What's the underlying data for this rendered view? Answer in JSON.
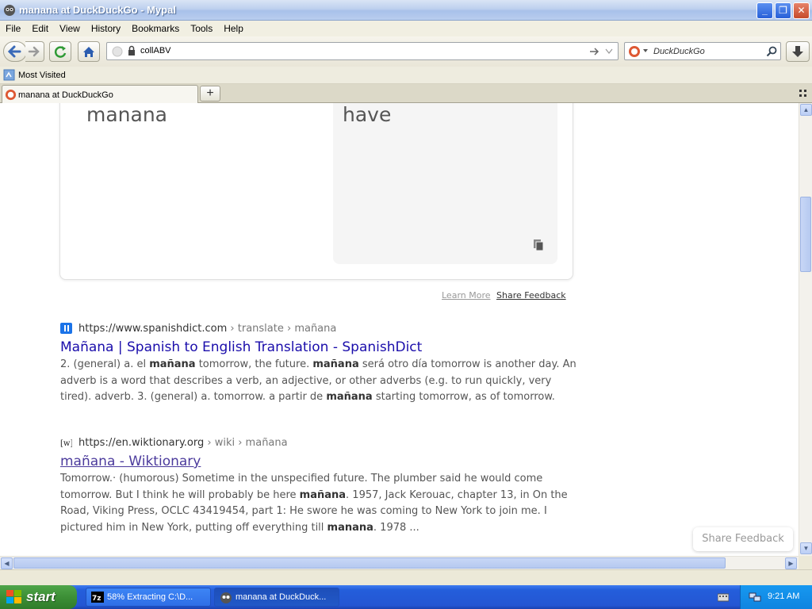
{
  "window": {
    "title": "manana at DuckDuckGo - Mypal"
  },
  "menu": [
    "File",
    "Edit",
    "View",
    "History",
    "Bookmarks",
    "Tools",
    "Help"
  ],
  "navbar": {
    "url": "collABV",
    "search_placeholder": "DuckDuckGo"
  },
  "bookmarks": {
    "most_visited": "Most Visited"
  },
  "tabs": [
    {
      "label": "manana at DuckDuckGo"
    }
  ],
  "translate": {
    "source_text": "manana",
    "target_text": "have",
    "learn_more": "Learn More",
    "share_feedback": "Share Feedback"
  },
  "results": [
    {
      "domain": "https://www.spanishdict.com",
      "path": " › translate › mañana",
      "title": "Mañana | Spanish to English Translation - SpanishDict",
      "snippet_html": "2. (general) a. el <b>mañana</b> tomorrow, the future. <b>mañana</b> será otro día tomorrow is another day. An adverb is a word that describes a verb, an adjective, or other adverbs (e.g. to run quickly, very tired). adverb. 3. (general) a. tomorrow. a partir de <b>mañana</b> starting tomorrow, as of tomorrow."
    },
    {
      "domain": "https://en.wiktionary.org",
      "path": " › wiki › mañana",
      "title": "mañana - Wiktionary",
      "snippet_html": "Tomorrow.· (humorous) Sometime in the unspecified future. The plumber said he would come tomorrow. But I think he will probably be here <b>mañana</b>. 1957, Jack Kerouac, chapter 13, in On the Road, Viking Press, OCLC 43419454, part 1: He swore he was coming to New York to join me. I pictured him in New York, putting off everything till <b>manana</b>. 1978 ..."
    }
  ],
  "floating_feedback": "Share Feedback",
  "taskbar": {
    "start": "start",
    "items": [
      "58% Extracting C:\\D...",
      "manana at DuckDuck..."
    ],
    "clock": "9:21 AM"
  }
}
